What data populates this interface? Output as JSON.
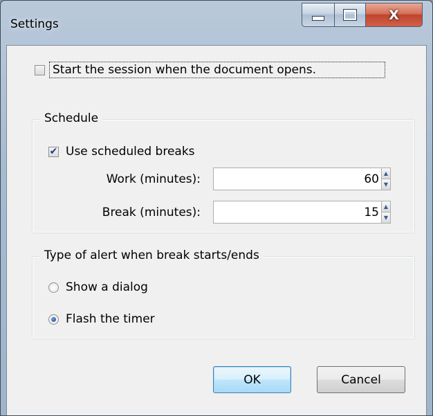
{
  "window": {
    "title": "Settings",
    "close_glyph": "X"
  },
  "start_session": {
    "label": "Start the session when the document opens.",
    "checked": false
  },
  "schedule": {
    "legend": "Schedule",
    "use_breaks_label": "Use scheduled breaks",
    "use_breaks_checked": true,
    "work_label": "Work (minutes):",
    "work_value": "60",
    "break_label": "Break (minutes):",
    "break_value": "15"
  },
  "alert": {
    "legend": "Type of alert when break starts/ends",
    "options": [
      {
        "label": "Show a dialog",
        "selected": false
      },
      {
        "label": "Flash the timer",
        "selected": true
      }
    ]
  },
  "buttons": {
    "ok": "OK",
    "cancel": "Cancel"
  },
  "glyphs": {
    "check": "✔",
    "up": "▲",
    "down": "▼"
  }
}
